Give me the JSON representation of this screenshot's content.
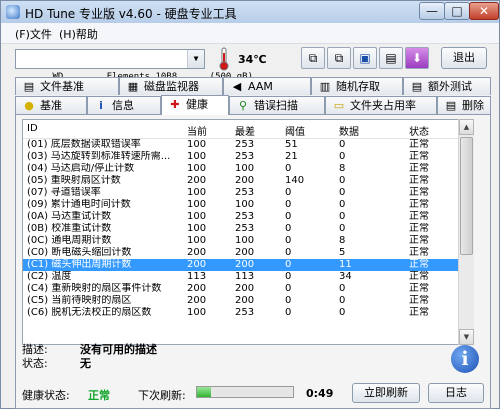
{
  "window": {
    "title": "HD Tune 专业版 v4.60 - 硬盘专业工具",
    "minimize_glyph": "—",
    "maximize_glyph": "□",
    "close_glyph": "✕"
  },
  "menu": [
    {
      "label": "(F)文件"
    },
    {
      "label": "(H)帮助"
    }
  ],
  "toolbar": {
    "drive": "WD        Elements 10B8      (500 gB)",
    "dropdown_glyph": "▼",
    "temperature": "34℃",
    "exit_label": "退出",
    "buttons": [
      {
        "icon": "copy-icon",
        "glyph": "⧉"
      },
      {
        "icon": "copy-info-icon",
        "glyph": "⧉"
      },
      {
        "icon": "save-icon",
        "glyph": "▣"
      },
      {
        "icon": "options-icon",
        "glyph": "▤"
      },
      {
        "icon": "download-icon",
        "glyph": "⬇"
      }
    ]
  },
  "tabs_row1": [
    {
      "label": "文件基准",
      "icon": "document-icon",
      "glyph": "▤"
    },
    {
      "label": "磁盘监视器",
      "icon": "monitor-icon",
      "glyph": "▦"
    },
    {
      "label": "AAM",
      "icon": "speaker-icon",
      "glyph": "◀"
    },
    {
      "label": "随机存取",
      "icon": "random-access-icon",
      "glyph": "▥"
    },
    {
      "label": "额外测试",
      "icon": "extra-tests-icon",
      "glyph": "▤"
    }
  ],
  "tabs_row2": [
    {
      "label": "基准",
      "icon": "benchmark-icon",
      "glyph": "●"
    },
    {
      "label": "信息",
      "icon": "info-icon",
      "glyph": "i"
    },
    {
      "label": "健康",
      "icon": "health-icon",
      "glyph": "✚"
    },
    {
      "label": "错误扫描",
      "icon": "magnifier-icon",
      "glyph": "⚲"
    },
    {
      "label": "文件夹占用率",
      "icon": "folder-icon",
      "glyph": "▭"
    },
    {
      "label": "删除",
      "icon": "delete-icon",
      "glyph": "▤"
    }
  ],
  "active_tab": "健康",
  "table": {
    "columns": [
      "ID",
      "当前",
      "最差",
      "阈值",
      "数据",
      "状态"
    ],
    "rows": [
      {
        "id": "(01) 底层数据读取错误率",
        "cur": "100",
        "worst": "253",
        "thr": "51",
        "data": "0",
        "status": "正常"
      },
      {
        "id": "(03) 马达旋转到标准转速所需...",
        "cur": "100",
        "worst": "253",
        "thr": "21",
        "data": "0",
        "status": "正常"
      },
      {
        "id": "(04) 马达启动/停止计数",
        "cur": "100",
        "worst": "100",
        "thr": "0",
        "data": "8",
        "status": "正常"
      },
      {
        "id": "(05) 重映射扇区计数",
        "cur": "200",
        "worst": "200",
        "thr": "140",
        "data": "0",
        "status": "正常"
      },
      {
        "id": "(07) 寻道错误率",
        "cur": "100",
        "worst": "253",
        "thr": "0",
        "data": "0",
        "status": "正常"
      },
      {
        "id": "(09) 累计通电时间计数",
        "cur": "100",
        "worst": "100",
        "thr": "0",
        "data": "0",
        "status": "正常"
      },
      {
        "id": "(0A) 马达重试计数",
        "cur": "100",
        "worst": "253",
        "thr": "0",
        "data": "0",
        "status": "正常"
      },
      {
        "id": "(0B) 校准重试计数",
        "cur": "100",
        "worst": "253",
        "thr": "0",
        "data": "0",
        "status": "正常"
      },
      {
        "id": "(0C) 通电周期计数",
        "cur": "100",
        "worst": "100",
        "thr": "0",
        "data": "8",
        "status": "正常"
      },
      {
        "id": "(C0) 断电磁头缩回计数",
        "cur": "200",
        "worst": "200",
        "thr": "0",
        "data": "5",
        "status": "正常"
      },
      {
        "id": "(C1) 磁头伸出周期计数",
        "cur": "200",
        "worst": "200",
        "thr": "0",
        "data": "11",
        "status": "正常",
        "selected": true
      },
      {
        "id": "(C2) 温度",
        "cur": "113",
        "worst": "113",
        "thr": "0",
        "data": "34",
        "status": "正常"
      },
      {
        "id": "(C4) 重新映射的扇区事件计数",
        "cur": "200",
        "worst": "200",
        "thr": "0",
        "data": "0",
        "status": "正常"
      },
      {
        "id": "(C5) 当前待映射的扇区",
        "cur": "200",
        "worst": "200",
        "thr": "0",
        "data": "0",
        "status": "正常"
      },
      {
        "id": "(C6) 脱机无法校正的扇区数",
        "cur": "100",
        "worst": "253",
        "thr": "0",
        "data": "0",
        "status": "正常"
      }
    ]
  },
  "details": {
    "desc_label": "描述:",
    "desc_value": "没有可用的描述",
    "state_label": "状态:",
    "state_value": "无"
  },
  "status": {
    "health_label": "健康状态:",
    "health_value": "正常",
    "next_refresh_label": "下次刷新:",
    "progress_fraction": 0.15,
    "time": "0:49",
    "refresh_button": "立即刷新",
    "log_button": "日志"
  },
  "colors": {
    "selection": "#3399ff",
    "health_ok": "#11a52a"
  }
}
